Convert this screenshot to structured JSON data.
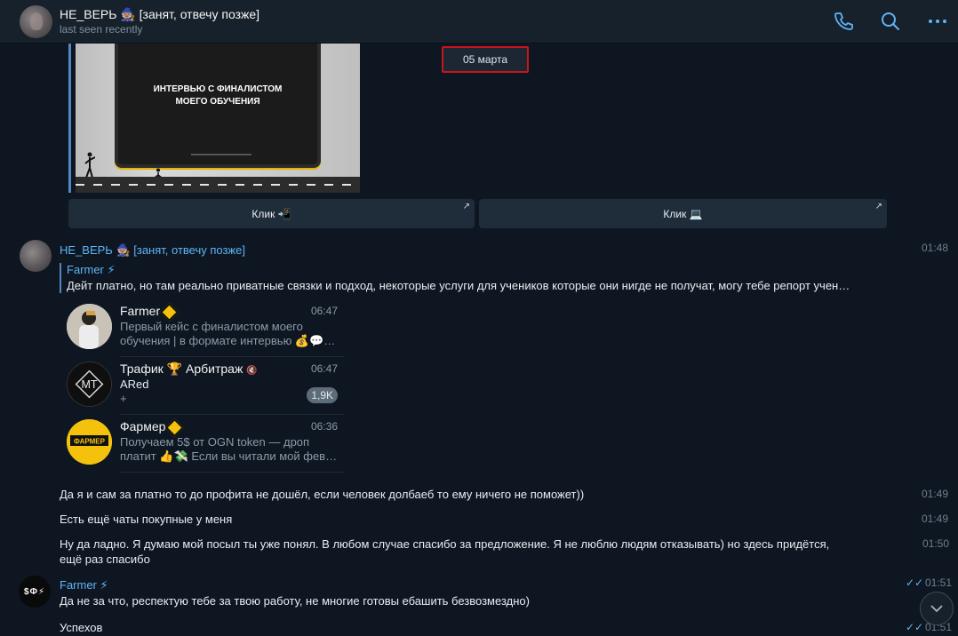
{
  "header": {
    "title": "НЕ_ВЕРЬ 🧙🏽 [занят, отвечу позже]",
    "subtitle": "last seen recently",
    "icons": [
      "phone-icon",
      "search-icon",
      "more-icon"
    ]
  },
  "media": {
    "screen_text_line1": "ИНТЕРВЬЮ С ФИНАЛИСТОМ",
    "screen_text_line2": "МОЕГО ОБУЧЕНИЯ"
  },
  "date_separator": "05 марта",
  "link_buttons": [
    {
      "label": "Клик 📲"
    },
    {
      "label": "Клик 💻"
    }
  ],
  "messages": {
    "m1": {
      "sender": "НЕ_ВЕРЬ 🧙🏽 [занят, отвечу позже]",
      "time": "01:48",
      "reply_name": "Farmer ⚡",
      "reply_text": "Дейт платно, но там реально приватные связки и подход, некоторые услуги для учеников которые они нигде не получат, могу тебе репорт учен…"
    },
    "chat_list": [
      {
        "name": "Farmer",
        "time": "06:47",
        "msg_line1": "Первый кейс с финалистом моего",
        "msg_line2": "обучения | в формате интервью 💰💬…"
      },
      {
        "name": "Трафик 🏆 Арбитраж",
        "time": "06:47",
        "msg_line1": "ARed",
        "msg_line2": "+",
        "badge": "1,9K",
        "avatar_text": "MT"
      },
      {
        "name": "Фармер",
        "time": "06:36",
        "msg_line1": "Получаем 5$ от OGN token — дроп",
        "msg_line2": "платит 👍💸 Если вы читали мой фев…",
        "avatar_text": "ФАРМЕР"
      }
    ],
    "m2": {
      "text": "Да я и сам за платно то до профита не дошёл, если человек долбаеб то ему ничего не поможет))",
      "time": "01:49"
    },
    "m3": {
      "text": "Есть ещё чаты покупные у меня",
      "time": "01:49"
    },
    "m4": {
      "text_line1": "Ну да ладно. Я думаю мой посыл ты уже понял. В любом случае спасибо за предложение. Я не люблю людям отказывать) но здесь придётся,",
      "text_line2": "ещё раз спасибо",
      "time": "01:50"
    },
    "m5": {
      "sender": "Farmer ⚡",
      "avatar_text": "$Ф⚡",
      "text": "Да не за что, респектую тебе за твою работу, не многие готовы ебашить безвозмездно)",
      "time": "01:51"
    },
    "m6": {
      "text": "Успехов",
      "time": "01:51"
    }
  }
}
